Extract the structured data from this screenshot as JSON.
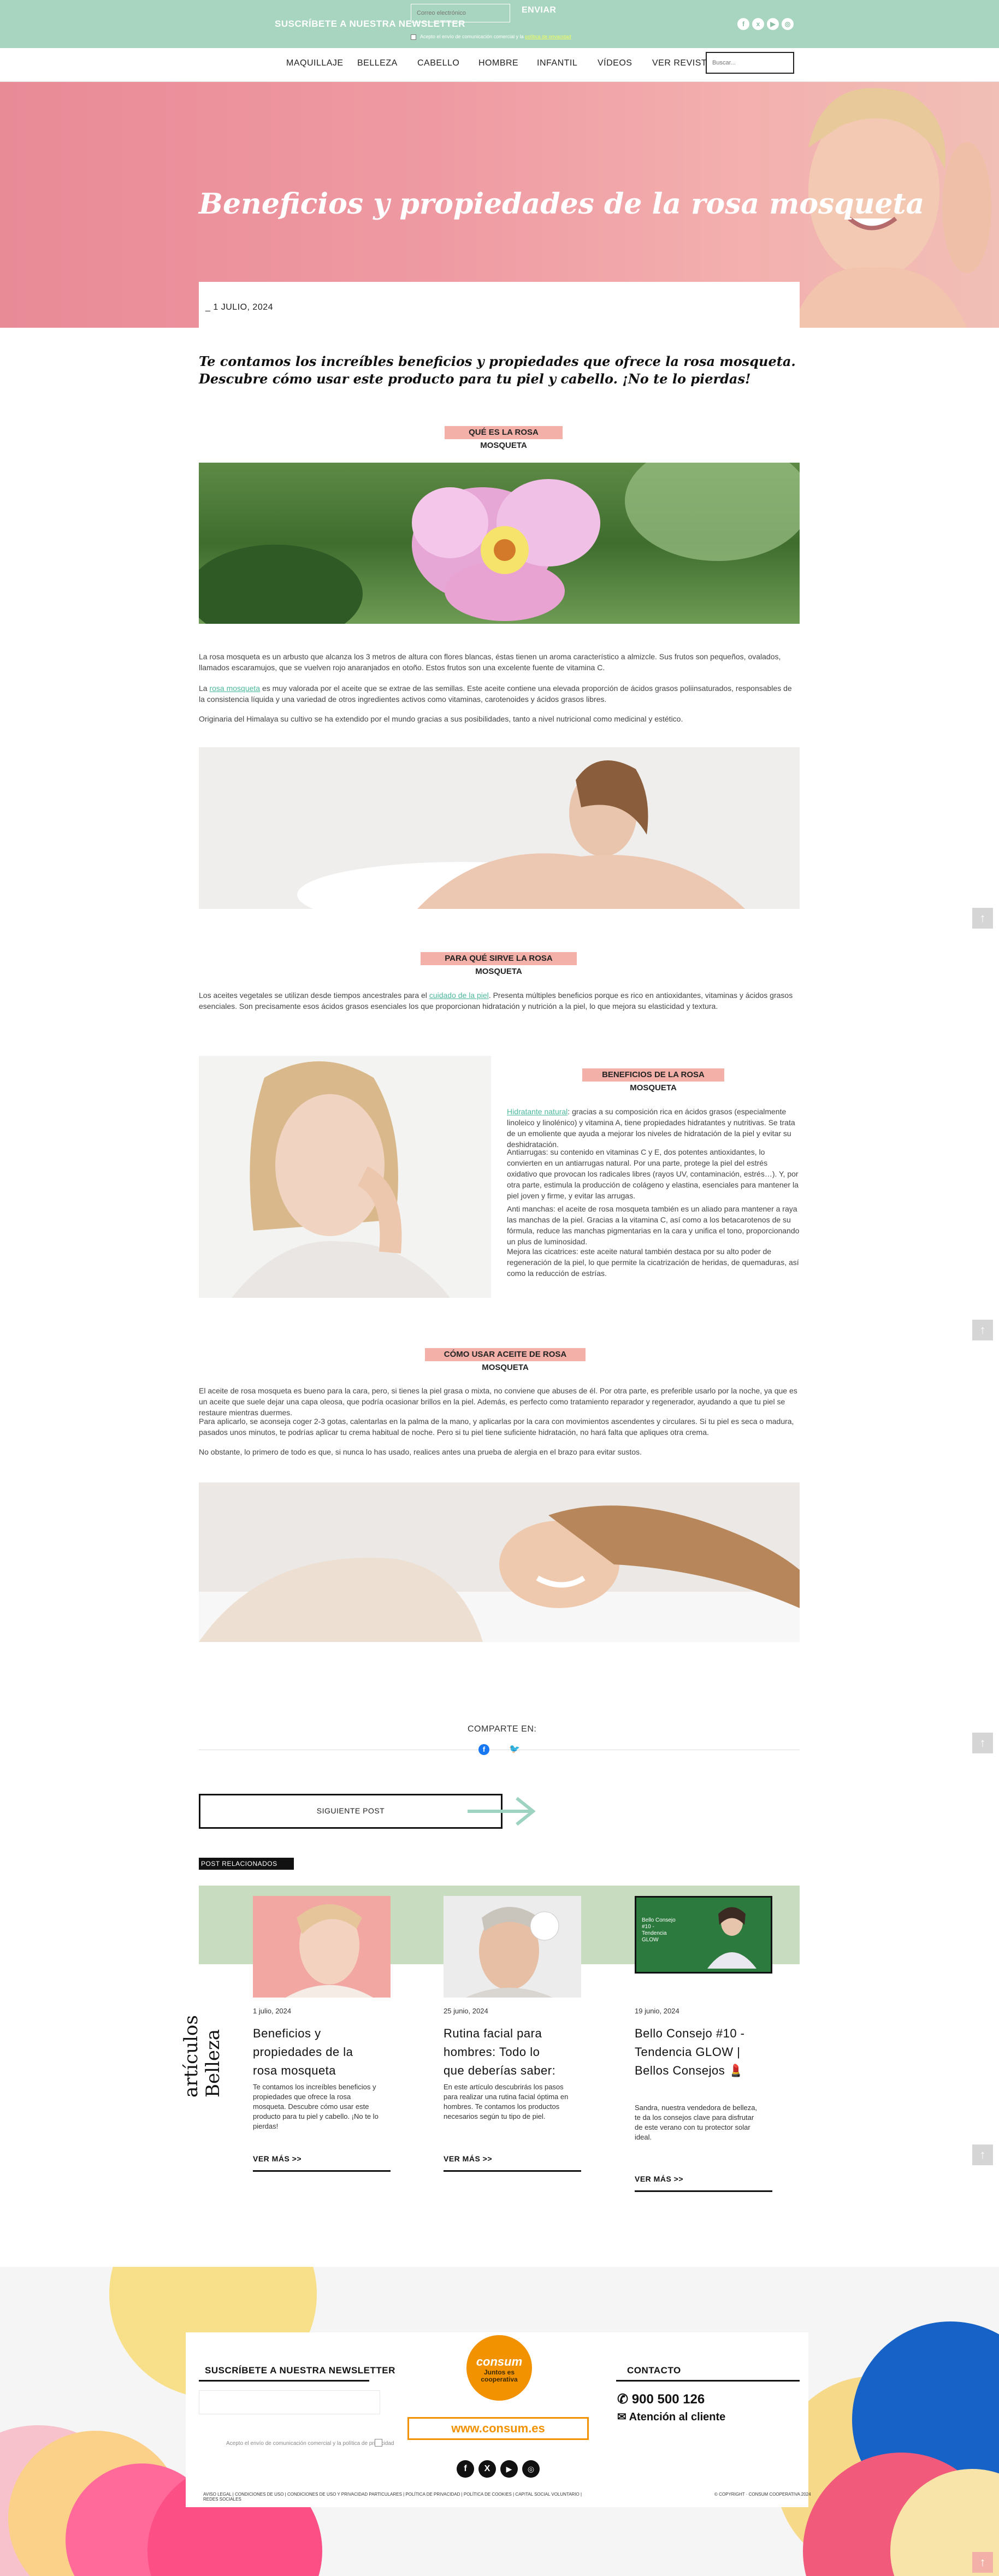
{
  "topbar": {
    "newsletter_label": "SUSCRÍBETE A NUESTRA NEWSLETTER",
    "email_placeholder": "Correo electrónico",
    "send_label": "ENVIAR",
    "accept_text": "Acepto el envío de comunicación comercial y la",
    "privacy_link": "política de privacidad"
  },
  "logo": {
    "brand": "consum",
    "tagline": "Juntos es cooperativa"
  },
  "nav": {
    "items": [
      "MAQUILLAJE",
      "BELLEZA",
      "CABELLO",
      "HOMBRE",
      "INFANTIL",
      "VÍDEOS",
      "VER REVISTA"
    ],
    "search_placeholder": "Buscar..."
  },
  "hero": {
    "title": "Beneficios y propiedades de la rosa mosqueta",
    "date": "1 JULIO, 2024"
  },
  "article": {
    "intro": "Te contamos los increíbles beneficios y propiedades que ofrece la rosa mosqueta. Descubre cómo usar este producto para tu piel y cabello. ¡No te lo pierdas!",
    "s1_title": "QUÉ ES LA ROSA MOSQUETA",
    "s1_p1": "La rosa mosqueta es un arbusto que alcanza los 3 metros de altura con flores blancas, éstas tienen un aroma característico a almizcle. Sus frutos son pequeños, ovalados, llamados escaramujos, que se vuelven rojo anaranjados en otoño. Estos frutos son una excelente fuente de vitamina C.",
    "s1_p2_link": "rosa mosqueta",
    "s1_p2_pre": "La",
    "s1_p2_post": "es muy valorada por el aceite que se extrae de las semillas. Este aceite contiene una elevada proporción de ácidos grasos poliinsaturados, responsables de la consistencia líquida y una variedad de otros ingredientes activos como vitaminas, carotenoides y ácidos grasos libres.",
    "s1_p3": "Originaria del Himalaya su cultivo se ha extendido por el mundo gracias a sus posibilidades, tanto a nivel nutricional como medicinal y estético.",
    "s2_title": "PARA QUÉ SIRVE LA ROSA MOSQUETA",
    "s2_p1_pre": "Los aceites vegetales se utilizan desde tiempos ancestrales para el",
    "s2_p1_link": "cuidado de la piel",
    "s2_p1_post": ". Presenta múltiples beneficios porque es rico en antioxidantes, vitaminas y ácidos grasos esenciales. Son precisamente esos ácidos grasos esenciales los que proporcionan hidratación y nutrición a la piel, lo que mejora su elasticidad y textura.",
    "s3_title": "BENEFICIOS DE LA ROSA MOSQUETA",
    "s3_p1_link": "Hidratante natural",
    "s3_p1_post": ": gracias a su composición rica en ácidos grasos (especialmente linoleico y linolénico) y vitamina A, tiene propiedades hidratantes y nutritivas. Se trata de un emoliente que ayuda a mejorar los niveles de hidratación de la piel y evitar su deshidratación.",
    "s3_p2": "Antiarrugas: su contenido en vitaminas C y E, dos potentes antioxidantes, lo convierten en un antiarrugas natural. Por una parte, protege la piel del estrés oxidativo que provocan los radicales libres (rayos UV, contaminación, estrés…). Y, por otra parte, estimula la producción de colágeno y elastina, esenciales para mantener la piel joven y firme, y evitar las arrugas.",
    "s3_p3": "Anti manchas: el aceite de rosa mosqueta también es un aliado para mantener a raya las manchas de la piel. Gracias a la vitamina C, así como a los betacarotenos de su fórmula, reduce las manchas pigmentarias en la cara y unifica el tono, proporcionando un plus de luminosidad.",
    "s3_p4": "Mejora las cicatrices: este aceite natural también destaca por su alto poder de regeneración de la piel, lo que permite la cicatrización de heridas, de quemaduras, así como la reducción de estrías.",
    "s4_title": "CÓMO USAR ACEITE DE ROSA MOSQUETA",
    "s4_p1": "El aceite de rosa mosqueta es bueno para la cara, pero, si tienes la piel grasa o mixta, no conviene que abuses de él. Por otra parte, es preferible usarlo por la noche, ya que es un aceite que suele dejar una capa oleosa, que podría ocasionar brillos en la piel. Además, es perfecto como tratamiento reparador y regenerador, ayudando a que tu piel se restaure mientras duermes.",
    "s4_p2": "Para aplicarlo, se aconseja coger 2-3 gotas, calentarlas en la palma de la mano, y aplicarlas por la cara con movimientos ascendentes y circulares. Si tu piel es seca o madura, pasados unos minutos, te podrías aplicar tu crema habitual de noche. Pero si tu piel tiene suficiente hidratación, no hará falta que apliques otra crema.",
    "s4_p3": "No obstante, lo primero de todo es que, si nunca lo has usado, realices antes una prueba de alergia en el brazo para evitar sustos."
  },
  "share": {
    "label": "COMPARTE EN:",
    "icons": [
      "facebook-icon",
      "twitter-icon"
    ]
  },
  "next_post": {
    "label": "SIGUIENTE POST"
  },
  "related": {
    "header": "POST RELACIONADOS",
    "side_title": "artículos Belleza",
    "more_label": "VER MÁS >>",
    "cards": [
      {
        "date": "1 julio, 2024",
        "title": "Beneficios y propiedades de la rosa mosqueta",
        "excerpt": "Te contamos los increíbles beneficios y propiedades que ofrece la rosa mosqueta. Descubre cómo usar este producto para tu piel y cabello. ¡No te lo pierdas!"
      },
      {
        "date": "25 junio, 2024",
        "title": "Rutina facial para hombres: Todo lo que deberías saber:",
        "excerpt": "En este artículo descubrirás los pasos para realizar una rutina facial óptima en hombres. Te contamos los productos necesarios según tu tipo de piel."
      },
      {
        "date": "19 junio, 2024",
        "title": "Bello Consejo #10 - Tendencia GLOW | Bellos Consejos 💄",
        "excerpt": "Sandra, nuestra vendedora de belleza, te da los consejos clave para disfrutar de este verano con tu protector solar ideal.",
        "video_title": "Bello Consejo #10 - Tendencia GLOW"
      }
    ]
  },
  "footer": {
    "newsletter_title": "SUSCRÍBETE A NUESTRA NEWSLETTER",
    "accept_text": "Acepto el envío de comunicación comercial y la política de privacidad",
    "website": "www.consum.es",
    "contact_title": "CONTACTO",
    "phone": "900 500 126",
    "customer_service": "Atención al cliente",
    "legal_links": "AVISO LEGAL | CONDICIONES DE USO | CONDICIONES DE USO Y PRIVACIDAD PARTICULARES | POLÍTICA DE PRIVACIDAD | POLÍTICA DE COOKIES | CAPITAL SOCIAL VOLUNTARIO | REDES SOCIALES",
    "copyright": "© COPYRIGHT · CONSUM COOPERATIVA 2024"
  },
  "colors": {
    "topbar": "#a8d5bf",
    "accent_pink": "#f2b0a8",
    "brand_orange": "#f39200",
    "link_green": "#4cb89c"
  }
}
